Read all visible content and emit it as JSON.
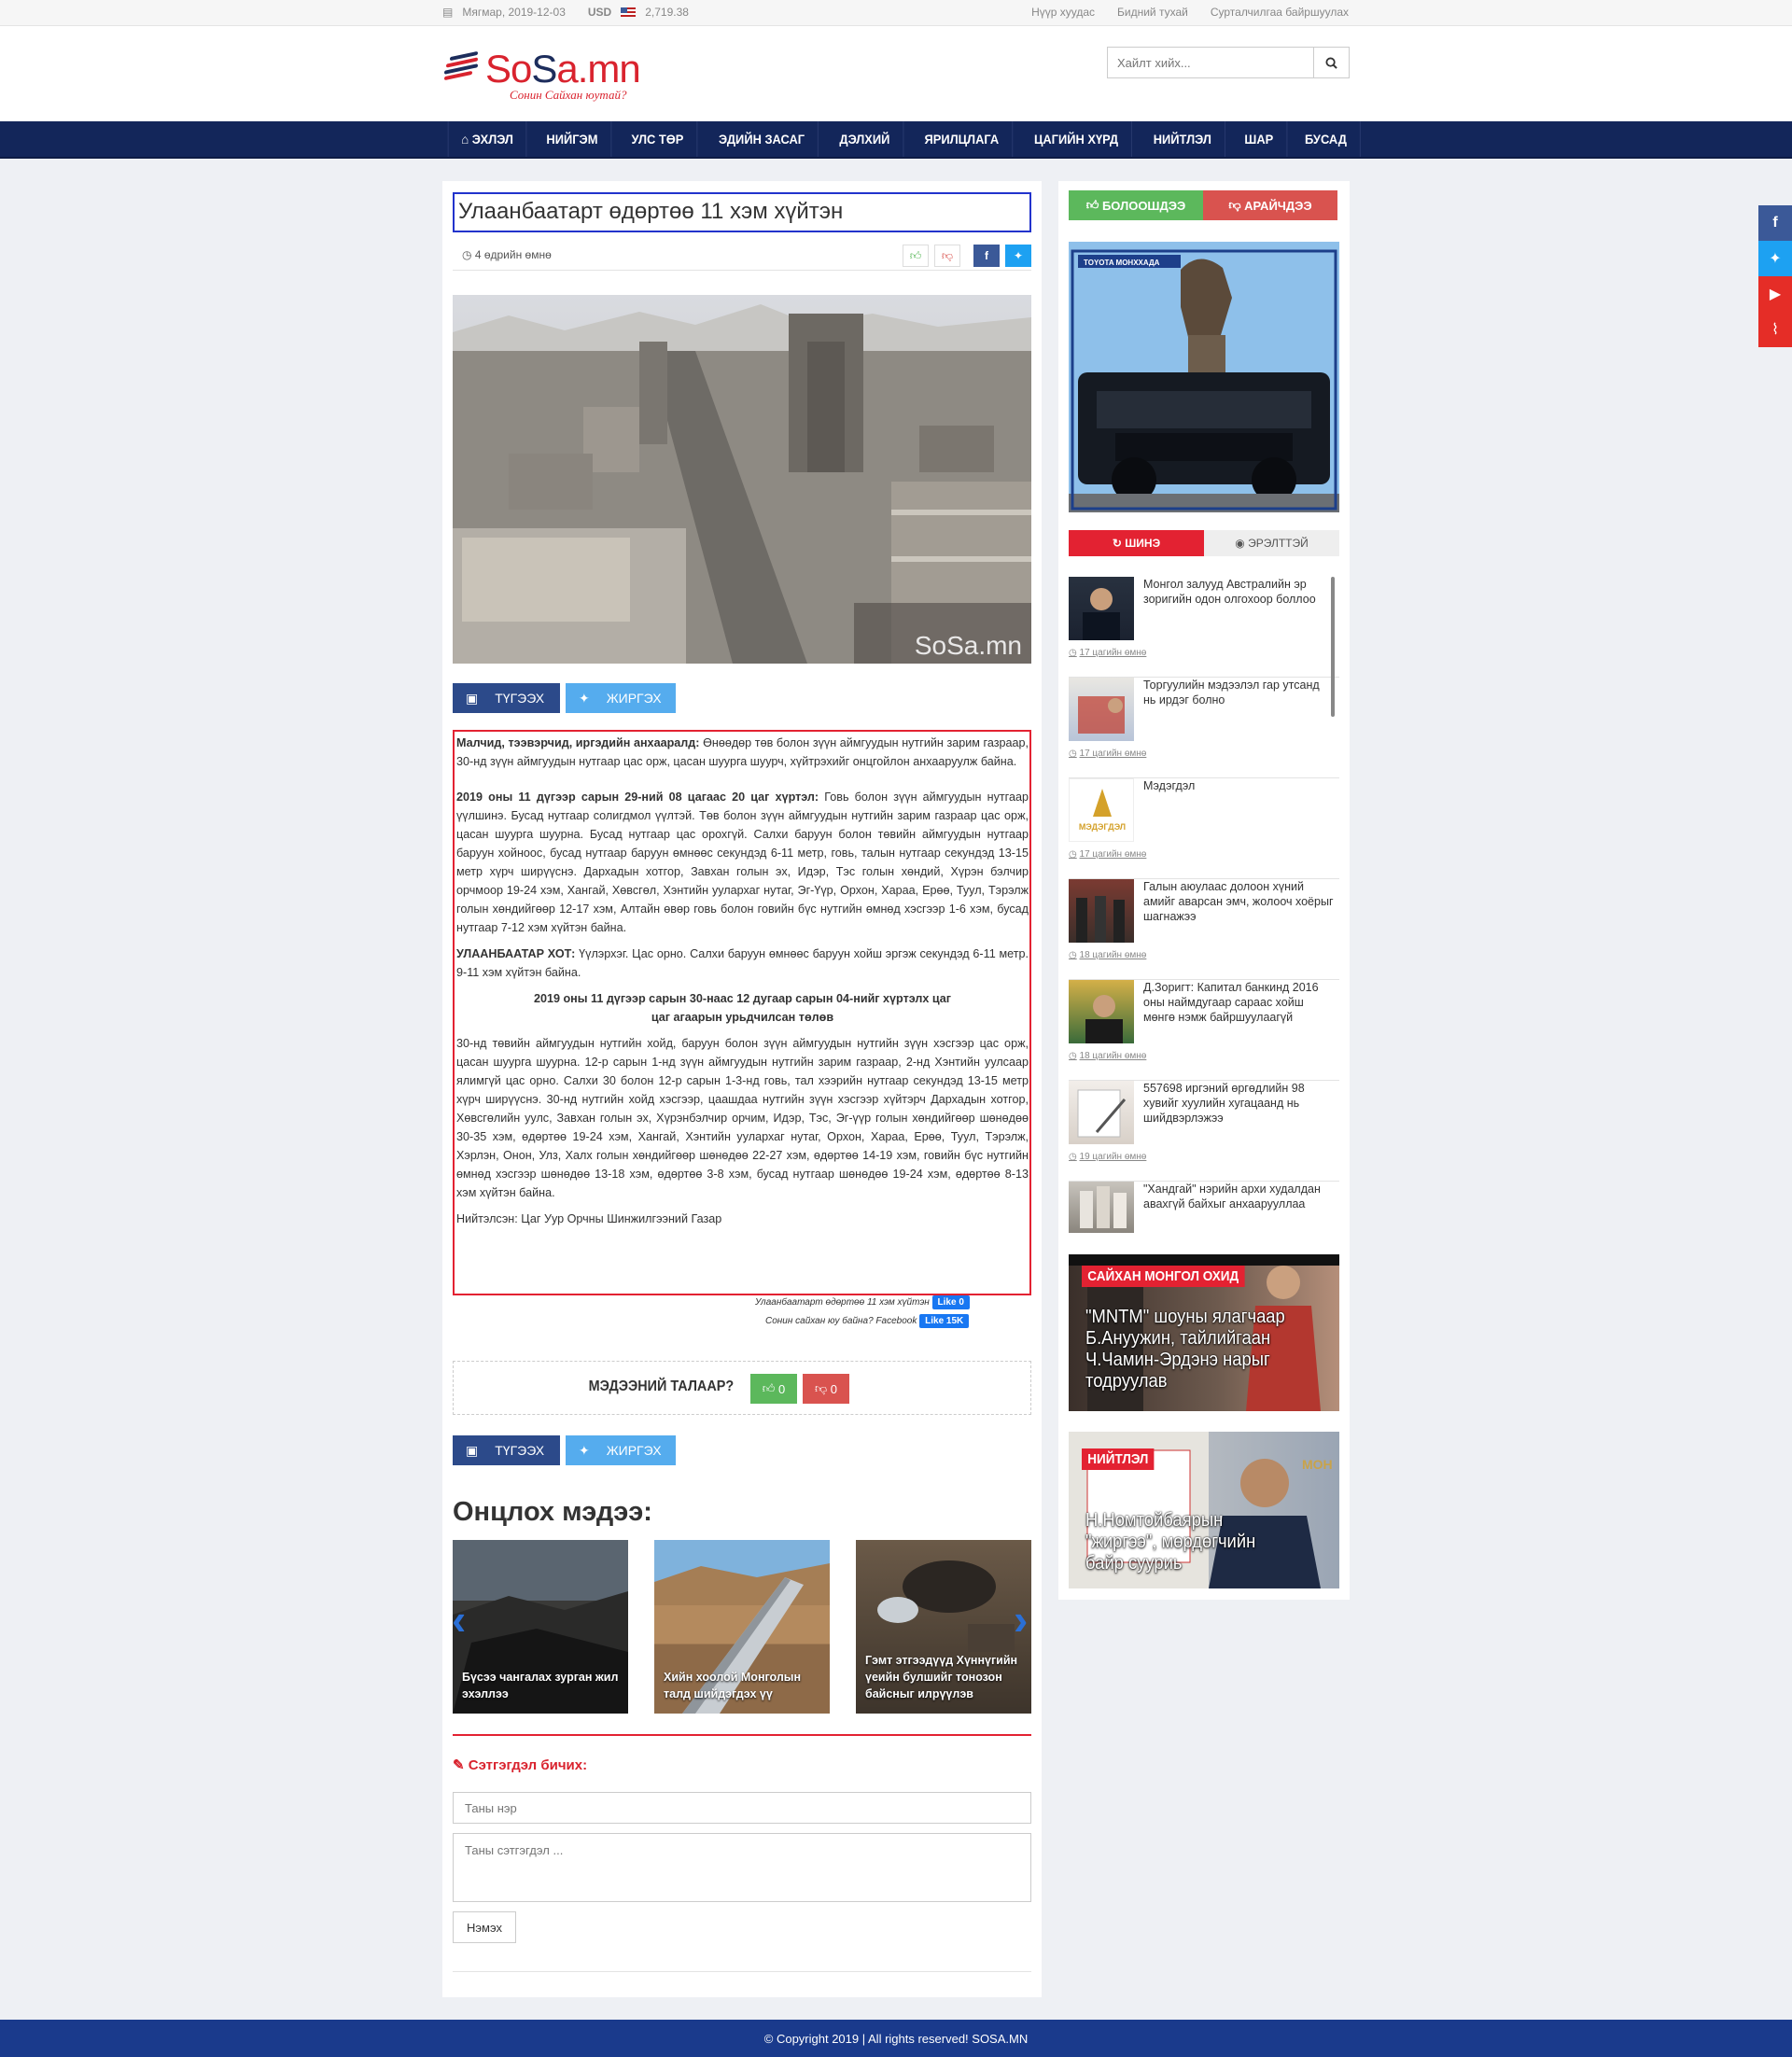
{
  "topbar": {
    "date": "Мягмар, 2019-12-03",
    "currency": "USD",
    "rate": "2,719.38",
    "links": [
      "Нүүр хуудас",
      "Бидний тухай",
      "Сурталчилгаа байршуулах"
    ]
  },
  "logo": {
    "name_a": "So",
    "name_b": "S",
    "name_c": "a.mn",
    "tagline": "Сонин Сайхан юутай?"
  },
  "search": {
    "placeholder": "Хайлт хийх..."
  },
  "nav": [
    "Эхлэл",
    "Нийгэм",
    "Улс төр",
    "Эдийн засаг",
    "Дэлхий",
    "Ярилцлага",
    "Цагийн хүрд",
    "Нийтлэл",
    "Шар",
    "Бусад"
  ],
  "article": {
    "title": "Улаанбаатарт өдөртөө 11 хэм хүйтэн",
    "time": "4 өдрийн өмнө",
    "watermark": "SoSa.mn",
    "share_fb": "ТҮГЭЭХ",
    "share_tw": "ЖИРГЭХ",
    "p1_bold": "Малчид, тээвэрчид, иргэдийн анхааралд:",
    "p1": " Өнөөдөр төв болон зүүн аймгуудын нутгийн зарим газраар, 30-нд зүүн аймгуудын нутгаар цас орж, цасан шуурга шуурч, хүйтрэхийг онцгойлон анхааруулж байна.",
    "p2_bold": "2019 оны 11 дүгээр сарын 29-ний 08 цагаас 20 цаг хүртэл:",
    "p2": " Говь болон зүүн аймгуудын нутгаар үүлшинэ. Бусад нутгаар солигдмол үүлтэй. Төв болон зүүн аймгуудын нутгийн зарим газраар цас орж, цасан шуурга шуурна. Бусад нутгаар цас орохгүй. Салхи баруун болон төвийн аймгуудын нутгаар баруун хойноос, бусад нутгаар баруун өмнөөс секундэд 6-11 метр, говь, талын нутгаар секундэд 13-15 метр хүрч ширүүснэ. Дархадын хотгор, Завхан голын эх, Идэр, Тэс  голын хөндий, Хүрэн бэлчир орчмоор  19-24 хэм, Хангай, Хөвсгөл, Хэнтийн уулархаг нутаг, Эг-Үүр, Орхон, Хараа, Ерөө, Туул, Тэрэлж голын хөндийгөөр 12-17 хэм, Алтайн өвөр говь болон говийн бүс нутгийн өмнөд хэсгээр 1-6 хэм, бусад нутгаар 7-12 хэм хүйтэн байна.",
    "p3_bold": "УЛААНБААТАР ХОТ:",
    "p3": " Үүлэрхэг. Цас орно. Салхи баруун өмнөөс баруун хойш эргэж секундэд 6-11 метр. 9-11 хэм хүйтэн байна.",
    "p4_line1": "2019 оны 11 дүгээр сарын 30-наас 12 дугаар сарын 04-нийг хүртэлх цаг",
    "p4_line2": "цаг агаарын урьдчилсан төлөв",
    "p5": "30-нд төвийн аймгуудын нутгийн хойд, баруун болон зүүн аймгуудын нутгийн зүүн хэсгээр цас орж, цасан шуурга шуурна. 12-р сарын 1-нд зүүн аймгуудын нутгийн зарим газраар, 2-нд Хэнтийн уулсаар ялимгүй цас орно. Салхи 30 болон 12-р сарын 1-3-нд говь, тал хээрийн нутгаар секундэд 13-15 метр хүрч ширүүснэ. 30-нд нутгийн хойд хэсгээр, цаашдаа нутгийн зүүн хэсгээр хүйтэрч Дархадын хотгор, Хөвсгөлийн уулс, Завхан голын эх, Хүрэнбэлчир орчим, Идэр, Тэс, Эг-үүр голын хөндийгөөр шөнөдөө 30-35 хэм, өдөртөө 19-24 хэм, Хангай, Хэнтийн уулархаг нутаг, Орхон, Хараа, Ерөө, Туул, Тэрэлж, Хэрлэн, Онон, Улз, Халх голын хөндийгөөр шөнөдөө 22-27 хэм, өдөртөө 14-19 хэм, говийн бүс нутгийн өмнөд хэсгээр шөнөдөө 13-18 хэм, өдөртөө 3-8 хэм, бусад нутгаар шөнөдөө 19-24 хэм, өдөртөө 8-13 хэм хүйтэн байна.",
    "source_label": "Нийтэлсэн: ",
    "source": "Цаг Уур Орчны Шинжилгээний Газар",
    "fb_like_text": "Улаанбаатарт өдөртөө 11 хэм хүйтэн",
    "fb_like": "Like 0",
    "fb_page_text": "Сонин сайхан юу байна? Facebook",
    "fb_page": "Like 15K",
    "opinion_q": "МЭДЭЭНИЙ ТАЛААР?",
    "opinion_yes": "0",
    "opinion_no": "0"
  },
  "featured": {
    "title": "Онцлох мэдээ:",
    "items": [
      {
        "caption": "Бүсээ чангалах зурган жил эхэллээ"
      },
      {
        "caption": "Хийн хоолой Монголын талд шийдэгдэх үү"
      },
      {
        "caption": "Гэмт этгээдүүд Хүннүгийн үеийн булшийг тонозон байсныг илрүүлэв"
      }
    ]
  },
  "comment": {
    "title": "Сэтгэгдэл бичих:",
    "name_placeholder": "Таны нэр",
    "text_placeholder": "Таны сэтгэгдэл ...",
    "submit": "Нэмэх"
  },
  "sidebar": {
    "vote_yes": "БОЛООШДЭЭ",
    "vote_no": "АРАЙЧДЭЭ",
    "ad_brand": "TOYOTA",
    "ad_dealer": "МОНХХАДА",
    "tab_new": "ШИНЭ",
    "tab_hot": "ЭРЭЛТТЭЙ",
    "news": [
      {
        "title": "Монгол залууд Австралийн эр зоригийн одон олгохоор боллоо",
        "time": "17 цагийн өмнө"
      },
      {
        "title": "Торгуулийн мэдээлэл гар утсанд нь ирдэг болно",
        "time": "17 цагийн өмнө"
      },
      {
        "title": "Мэдэгдэл",
        "time": "17 цагийн өмнө"
      },
      {
        "title": "Галын аюулаас долоон хүний амийг аварсан эмч, жолооч хоёрыг шагнажээ",
        "time": "18 цагийн өмнө"
      },
      {
        "title": "Д.Зоригт: Капитал банкинд 2016 оны наймдугаар сараас хойш мөнгө нэмж байршуулаагүй",
        "time": "18 цагийн өмнө"
      },
      {
        "title": "557698 иргэний өргөдлийн 98 хувийг хуулийн хугацаанд нь шийдвэрлэжээ",
        "time": "19 цагийн өмнө"
      },
      {
        "title": "\"Хандгай\" нэрийн архи худалдан авахгүй байхыг анхаарууллаа",
        "time": ""
      }
    ],
    "promo1": {
      "label": "САЙХАН МОНГОЛ ОХИД",
      "title": "\"MNTM\" шоуны ялагчаар Б.Ануужин, тайлийгаан Ч.Чамин-Эрдэнэ нарыг тодруулав"
    },
    "promo2": {
      "label": "НИЙТЛЭЛ",
      "title": "Н.Номтойбаярын \"жиргээ\", мөрдөгчийн байр сууриь"
    }
  },
  "footer": "© Copyright 2019 | All rights reserved! SOSA.MN",
  "colors": {
    "brand_red": "#d9232e",
    "nav_blue": "#13265a",
    "footer_blue": "#1a3a8c"
  }
}
